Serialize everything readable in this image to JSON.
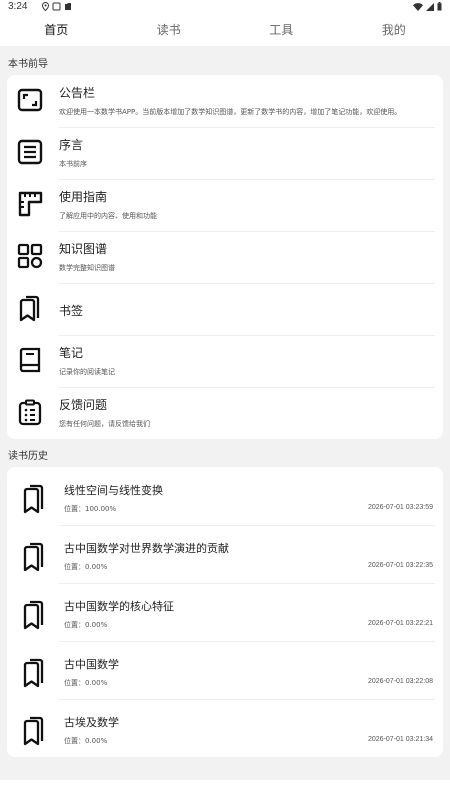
{
  "status": {
    "time": "3:24"
  },
  "tabs": [
    {
      "label": "首页",
      "active": true
    },
    {
      "label": "读书",
      "active": false
    },
    {
      "label": "工具",
      "active": false
    },
    {
      "label": "我的",
      "active": false
    }
  ],
  "guide": {
    "section_title": "本书前导",
    "items": [
      {
        "icon": "screen-frame-icon",
        "title": "公告栏",
        "subtitle": "欢迎使用一本数学书APP。当前版本增加了数学知识图谱，更新了数学书的内容，增加了笔记功能，欢迎使用。"
      },
      {
        "icon": "document-lines-icon",
        "title": "序言",
        "subtitle": "本书前序"
      },
      {
        "icon": "ruler-icon",
        "title": "使用指南",
        "subtitle": "了解应用中的内容、使用和功能"
      },
      {
        "icon": "grid-icon",
        "title": "知识图谱",
        "subtitle": "数学完整知识图谱"
      },
      {
        "icon": "bookmark-icon",
        "title": "书签",
        "subtitle": ""
      },
      {
        "icon": "book-icon",
        "title": "笔记",
        "subtitle": "记录你的阅读笔记"
      },
      {
        "icon": "clipboard-icon",
        "title": "反馈问题",
        "subtitle": "您有任何问题，请反馈给我们"
      }
    ]
  },
  "history": {
    "section_title": "读书历史",
    "items": [
      {
        "title": "线性空间与线性变换",
        "position": "位置：100.00%",
        "date": "2026-07-01 03:23:59"
      },
      {
        "title": "古中国数学对世界数学演进的贡献",
        "position": "位置：0.00%",
        "date": "2026-07-01 03:22:35"
      },
      {
        "title": "古中国数学的核心特征",
        "position": "位置：0.00%",
        "date": "2026-07-01 03:22:21"
      },
      {
        "title": "古中国数学",
        "position": "位置：0.00%",
        "date": "2026-07-01 03:22:08"
      },
      {
        "title": "古埃及数学",
        "position": "位置：0.00%",
        "date": "2026-07-01 03:21:34"
      }
    ]
  }
}
